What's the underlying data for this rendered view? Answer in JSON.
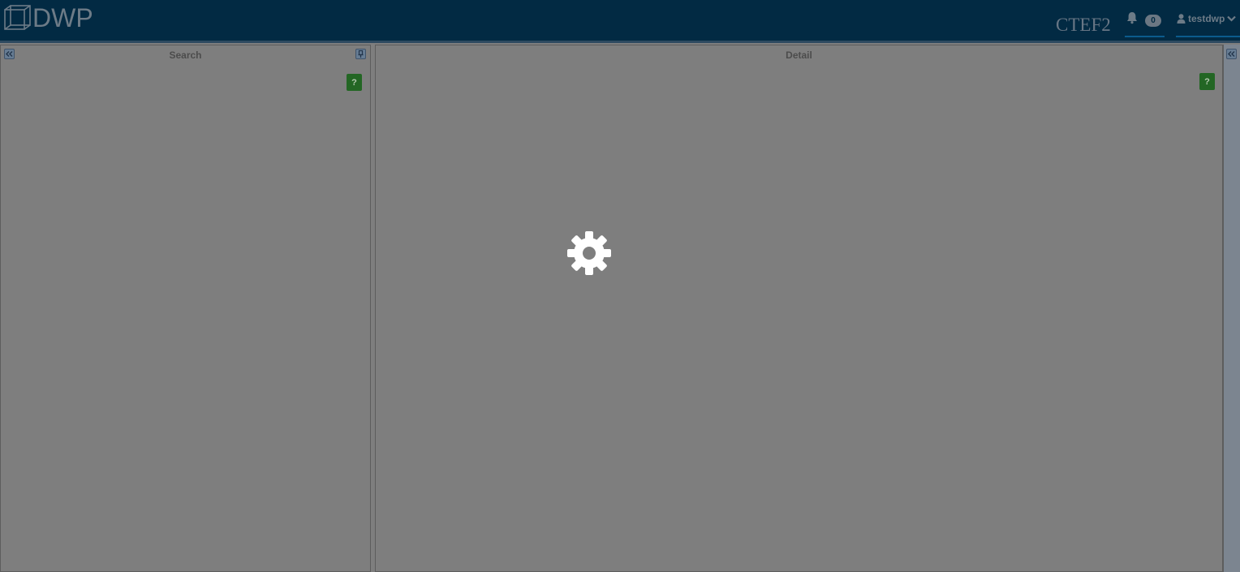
{
  "header": {
    "logo_text": "DWP",
    "environment": "CTEF2",
    "notifications": {
      "count": "0",
      "icon": "bell-icon"
    },
    "user": {
      "name": "testdwp",
      "icon": "user-icon",
      "menu_icon": "chevron-down-icon"
    },
    "background_color": "#022a43"
  },
  "panels": {
    "search": {
      "title": "Search",
      "collapse_icon": "double-chevron-left-icon",
      "pin_icon": "pin-icon",
      "help_label": "?"
    },
    "detail": {
      "title": "Detail",
      "help_label": "?"
    },
    "right_strip": {
      "expand_icon": "double-chevron-left-icon"
    }
  },
  "overlay": {
    "state": "loading",
    "icon": "gear-spinner-icon",
    "help_color": "#236624"
  }
}
